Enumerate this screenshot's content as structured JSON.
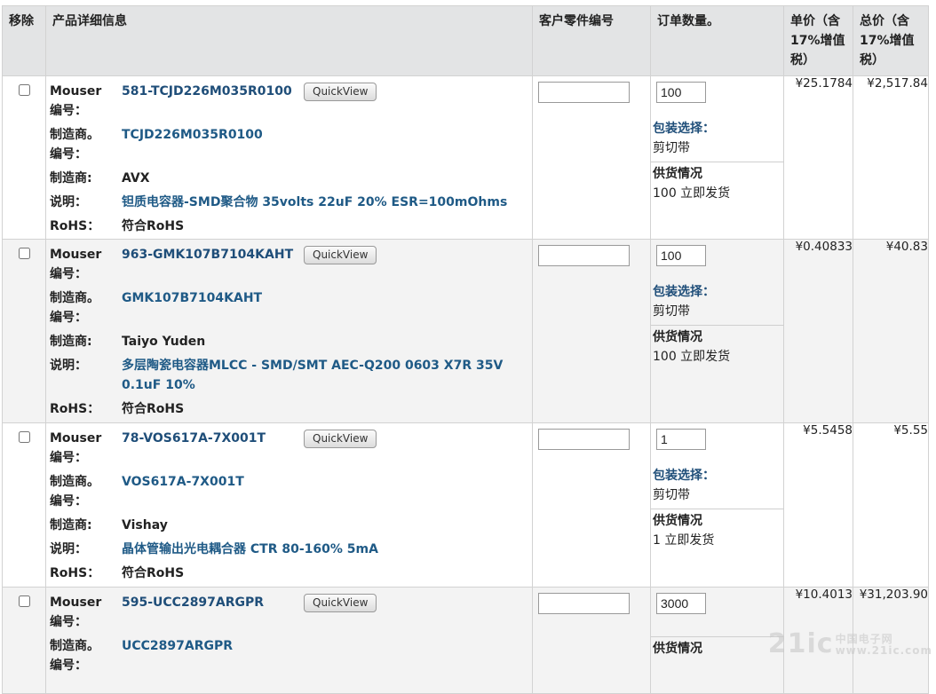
{
  "headers": {
    "remove": "移除",
    "details": "产品详细信息",
    "customer_part": "客户零件编号",
    "qty": "订单数量。",
    "unit_price_l1": "单价（含",
    "unit_price_l2": "17%增值",
    "unit_price_l3": "税）",
    "total_price_l1": "总价（含",
    "total_price_l2": "17%增值",
    "total_price_l3": "税）"
  },
  "labels": {
    "mouser_l1": "Mouser",
    "mouser_l2": "编号：",
    "mfr_pn_l1": "制造商。",
    "mfr_pn_l2": "编号：",
    "mfr": "制造商:",
    "desc": "说明：",
    "rohs": "RoHS：",
    "quickview": "QuickView",
    "packaging": "包装选择：",
    "availability": "供货情况"
  },
  "items": [
    {
      "mouser_no": "581-TCJD226M035R0100",
      "mfr_no": "TCJD226M035R0100",
      "mfr": "AVX",
      "desc": "钽质电容器-SMD聚合物 35volts 22uF 20% ESR=100mOhms",
      "rohs": "符合RoHS",
      "customer_part": "",
      "qty": "100",
      "packaging": "剪切带",
      "stock": "100 立即发货",
      "unit_price": "¥25.1784",
      "total_price": "¥2,517.84"
    },
    {
      "mouser_no": "963-GMK107B7104KAHT",
      "mfr_no": "GMK107B7104KAHT",
      "mfr": "Taiyo Yuden",
      "desc": "多层陶瓷电容器MLCC - SMD/SMT AEC-Q200 0603 X7R 35V 0.1uF 10%",
      "rohs": "符合RoHS",
      "customer_part": "",
      "qty": "100",
      "packaging": "剪切带",
      "stock": "100 立即发货",
      "unit_price": "¥0.40833",
      "total_price": "¥40.83"
    },
    {
      "mouser_no": "78-VOS617A-7X001T",
      "mfr_no": "VOS617A-7X001T",
      "mfr": "Vishay",
      "desc": "晶体管输出光电耦合器 CTR 80-160% 5mA",
      "rohs": "符合RoHS",
      "customer_part": "",
      "qty": "1",
      "packaging": "剪切带",
      "stock": "1 立即发货",
      "unit_price": "¥5.5458",
      "total_price": "¥5.55"
    },
    {
      "mouser_no": "595-UCC2897ARGPR",
      "mfr_no": "UCC2897ARGPR",
      "customer_part": "",
      "qty": "3000",
      "unit_price": "¥10.4013",
      "total_price": "¥31,203.90"
    }
  ],
  "watermark": {
    "brand": "21ic",
    "sub_l1": "中国电子网",
    "sub_l2": "www.21ic.com"
  }
}
